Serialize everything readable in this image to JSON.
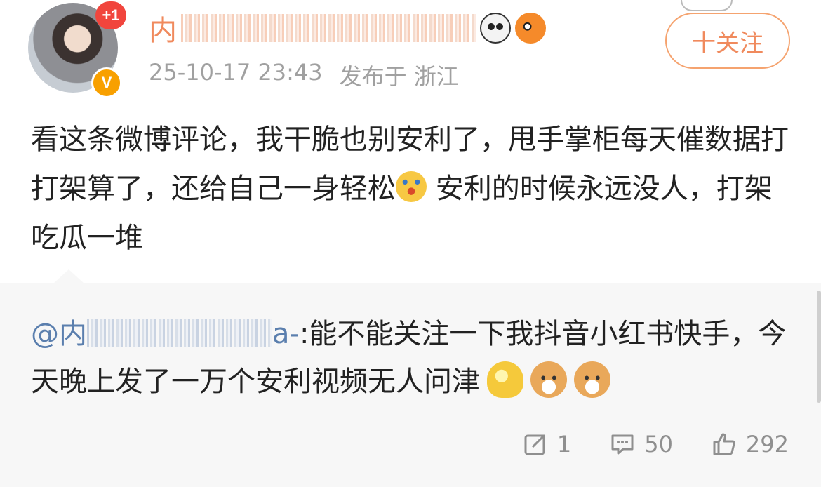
{
  "post": {
    "author": {
      "name_prefix": "内",
      "notification_badge": "+1",
      "verified_badge": "V"
    },
    "follow_button": "十关注",
    "timestamp": "25-10-17 23:43",
    "location": "发布于 浙江",
    "text_part1": "看这条微博评论，我干脆也别安利了，甩手掌柜每天催数据打打架算了，还给自己一身轻松",
    "text_part2": " 安利的时候永远没人，打架吃瓜一堆"
  },
  "repost": {
    "mention_prefix": "@内",
    "mention_suffix": "a-",
    "text": ":能不能关注一下我抖音小红书快手，今天晚上发了一万个安利视频无人问津"
  },
  "actions": {
    "repost_count": "1",
    "comment_count": "50",
    "like_count": "292"
  },
  "icons": {
    "panda": "panda-emoji-icon",
    "fish": "pufferfish-emoji-icon",
    "laugh": "laughing-tears-emoji-icon",
    "melt": "melting-face-emoji-icon",
    "dog": "dog-face-emoji-icon"
  }
}
